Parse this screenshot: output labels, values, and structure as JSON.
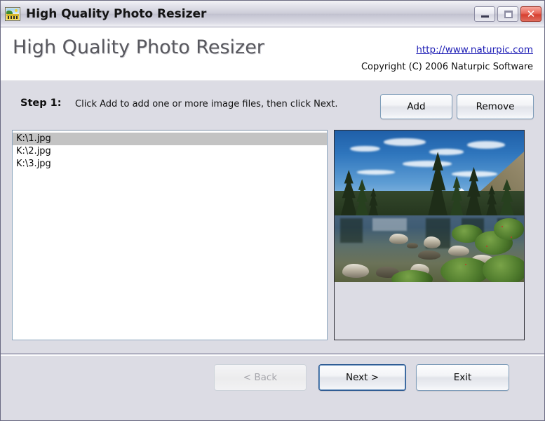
{
  "window": {
    "title": "High Quality Photo Resizer",
    "icon": "photo-resizer-icon",
    "controls": {
      "minimize": "minimize-icon",
      "maximize": "maximize-icon",
      "close": "✕"
    }
  },
  "header": {
    "title": "High Quality Photo Resizer",
    "link": "http://www.naturpic.com",
    "copyright": "Copyright (C) 2006 Naturpic Software"
  },
  "step": {
    "label": "Step 1:",
    "text": "Click Add to add one or more image files, then click Next."
  },
  "toolbar": {
    "add_label": "Add",
    "remove_label": "Remove"
  },
  "filelist": {
    "items": [
      {
        "name": "K:\\1.jpg",
        "selected": true
      },
      {
        "name": "K:\\2.jpg",
        "selected": false
      },
      {
        "name": "K:\\3.jpg",
        "selected": false
      }
    ]
  },
  "preview": {
    "description": "Mountain lake with pine trees, snowy peaks and blue sky"
  },
  "footer": {
    "back_label": "< Back",
    "next_label": "Next >",
    "exit_label": "Exit",
    "back_disabled": true
  },
  "colors": {
    "link": "#1d1db5",
    "selection": "#c3c3c3",
    "body": "#dcdce4",
    "default_button_border": "#2c5a92",
    "close_button": "#d63f2f"
  }
}
